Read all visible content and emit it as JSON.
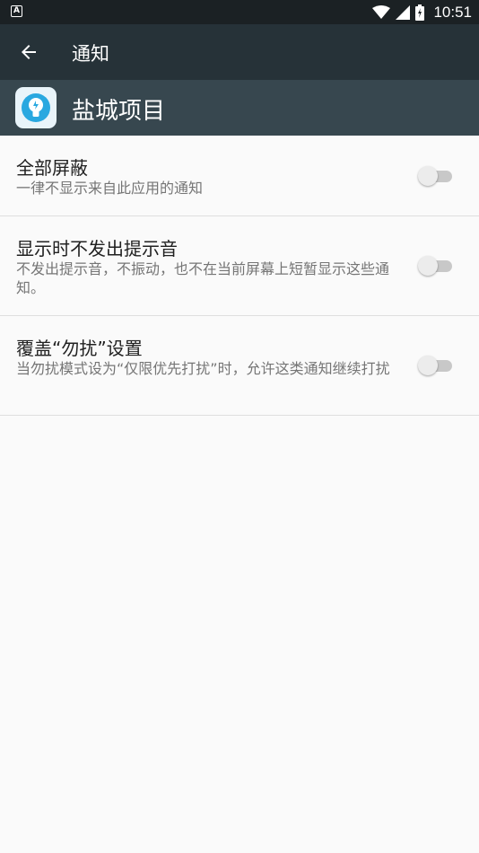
{
  "status_bar": {
    "time": "10:51",
    "left_icon": "A"
  },
  "toolbar": {
    "title": "通知",
    "back_icon": "arrow-left-icon"
  },
  "app": {
    "name": "盐城项目",
    "icon": "app-lightbulb-icon"
  },
  "settings": [
    {
      "title": "全部屏蔽",
      "summary": "一律不显示来自此应用的通知",
      "enabled": false
    },
    {
      "title": "显示时不发出提示音",
      "summary": "不发出提示音，不振动，也不在当前屏幕上短暂显示这些通知。",
      "enabled": false
    },
    {
      "title": "覆盖“勿扰”设置",
      "summary": "当勿扰模式设为“仅限优先打扰”时，允许这类通知继续打扰",
      "enabled": false
    }
  ]
}
